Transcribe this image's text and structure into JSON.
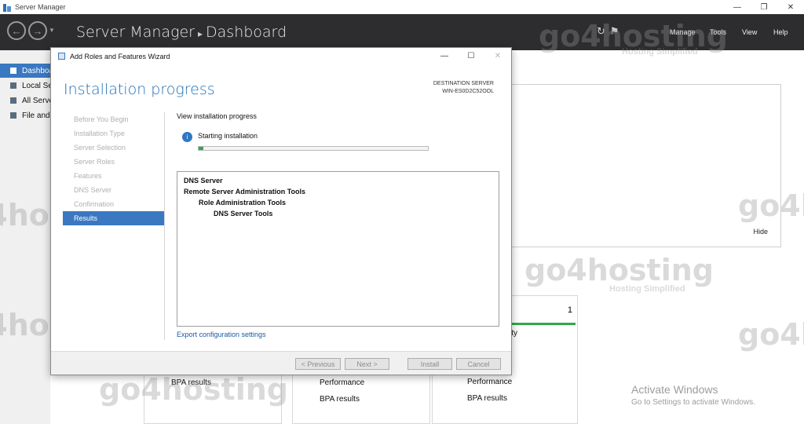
{
  "window": {
    "title": "Server Manager",
    "controls": [
      "—",
      "❐",
      "✕"
    ]
  },
  "header": {
    "breadcrumb_root": "Server Manager",
    "breadcrumb_sep": "▸",
    "breadcrumb_page": "Dashboard",
    "back_icon": "back-arrow-icon",
    "forward_icon": "forward-arrow-icon",
    "menu": [
      "Manage",
      "Tools",
      "View",
      "Help"
    ],
    "colors": {
      "bar": "#2d2d30",
      "accent": "#3a78c1"
    }
  },
  "sidebar": {
    "items": [
      {
        "label": "Dashboard",
        "icon": "dashboard-icon",
        "selected": true
      },
      {
        "label": "Local Server",
        "icon": "server-icon",
        "selected": false
      },
      {
        "label": "All Servers",
        "icon": "servers-icon",
        "selected": false
      },
      {
        "label": "File and Storage Services",
        "icon": "storage-icon",
        "selected": false
      }
    ]
  },
  "dashboard": {
    "hide_label": "Hide",
    "tile_count": "1",
    "tile_partial_text": "ity",
    "tiles": [
      {
        "labels": [
          "BPA results"
        ]
      },
      {
        "labels": [
          "Performance",
          "BPA results"
        ]
      },
      {
        "labels": [
          "Performance",
          "BPA results"
        ]
      }
    ],
    "activate_title": "Activate Windows",
    "activate_subtitle": "Go to Settings to activate Windows."
  },
  "watermark": {
    "text": "go4hosting",
    "tagline": "Hosting Simplified"
  },
  "wizard": {
    "title": "Add Roles and Features Wizard",
    "heading": "Installation progress",
    "destination_label": "DESTINATION SERVER",
    "destination_server": "WIN-ES0D2C52OOL",
    "steps": [
      {
        "label": "Before You Begin",
        "active": false
      },
      {
        "label": "Installation Type",
        "active": false
      },
      {
        "label": "Server Selection",
        "active": false
      },
      {
        "label": "Server Roles",
        "active": false
      },
      {
        "label": "Features",
        "active": false
      },
      {
        "label": "DNS Server",
        "active": false
      },
      {
        "label": "Confirmation",
        "active": false
      },
      {
        "label": "Results",
        "active": true
      }
    ],
    "view_progress_label": "View installation progress",
    "status_text": "Starting installation",
    "progress": 0.02,
    "results": [
      {
        "text": "DNS Server",
        "level": 0
      },
      {
        "text": "Remote Server Administration Tools",
        "level": 0
      },
      {
        "text": "Role Administration Tools",
        "level": 1
      },
      {
        "text": "DNS Server Tools",
        "level": 2
      }
    ],
    "export_link": "Export configuration settings",
    "buttons": {
      "previous": "< Previous",
      "next": "Next >",
      "install": "Install",
      "cancel": "Cancel"
    }
  }
}
